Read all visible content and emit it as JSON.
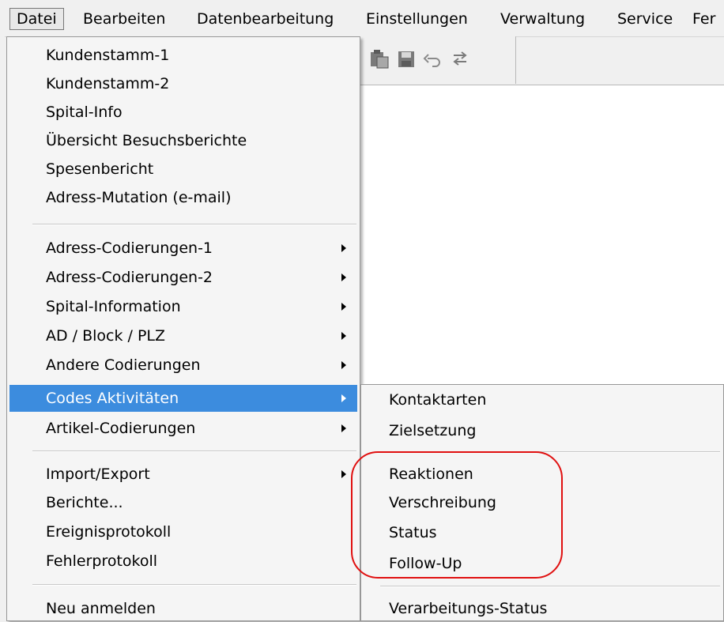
{
  "menubar": {
    "items": [
      "Datei",
      "Bearbeiten",
      "Datenbearbeitung",
      "Einstellungen",
      "Verwaltung",
      "Service",
      "Fer"
    ]
  },
  "toolbar": {
    "icons": [
      "paste-icon",
      "save-icon",
      "undo-icon",
      "redo-icon"
    ]
  },
  "datei_menu": {
    "items": [
      {
        "label": "Kundenstamm-1"
      },
      {
        "label": "Kundenstamm-2"
      },
      {
        "label": "Spital-Info"
      },
      {
        "label": "Übersicht Besuchsberichte"
      },
      {
        "label": "Spesenbericht"
      },
      {
        "label": "Adress-Mutation (e-mail)"
      },
      {
        "label": "Adress-Codierungen-1"
      },
      {
        "label": "Adress-Codierungen-2"
      },
      {
        "label": "Spital-Information"
      },
      {
        "label": "AD / Block / PLZ"
      },
      {
        "label": "Andere Codierungen"
      },
      {
        "label": "Codes Aktivitäten"
      },
      {
        "label": "Artikel-Codierungen"
      },
      {
        "label": "Import/Export"
      },
      {
        "label": "Berichte..."
      },
      {
        "label": "Ereignisprotokoll"
      },
      {
        "label": "Fehlerprotokoll"
      },
      {
        "label": "Neu anmelden"
      }
    ]
  },
  "codes_submenu": {
    "items": [
      {
        "label": "Kontaktarten"
      },
      {
        "label": "Zielsetzung"
      },
      {
        "label": "Reaktionen"
      },
      {
        "label": "Verschreibung"
      },
      {
        "label": "Status"
      },
      {
        "label": "Follow-Up"
      },
      {
        "label": "Verarbeitungs-Status"
      }
    ]
  },
  "colors": {
    "selection": "#3c8cde",
    "annotation_ring": "#e01010"
  }
}
